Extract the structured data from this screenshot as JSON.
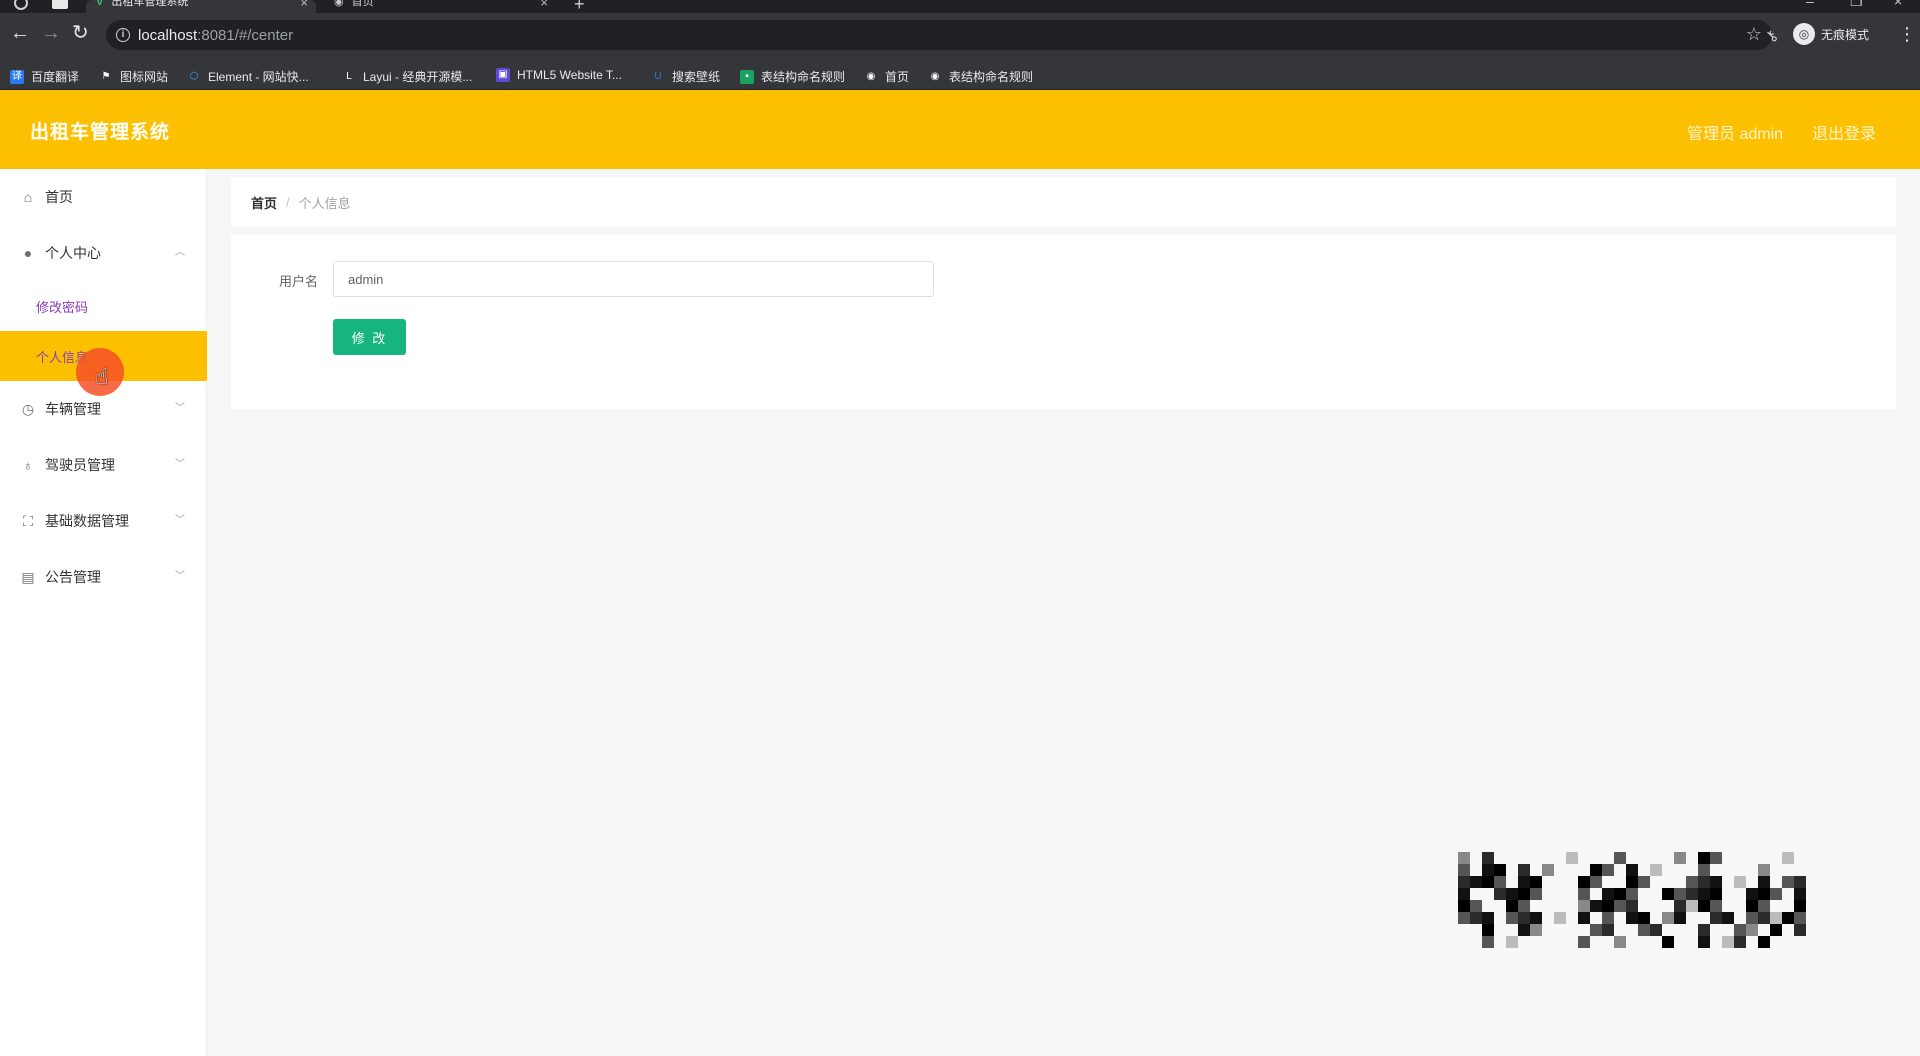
{
  "browser": {
    "tabs": [
      {
        "title": "出租车管理系统",
        "active": true
      },
      {
        "title": "首页",
        "active": false
      }
    ],
    "url_host": "localhost",
    "url_rest": ":8081/#/center",
    "profile_label": "无痕模式",
    "bookmarks": [
      {
        "label": "百度翻译",
        "icon_text": "译",
        "color": "#2b7bf0"
      },
      {
        "label": "图标网站",
        "icon_text": "⚑",
        "color": "#35363a"
      },
      {
        "label": "Element - 网站快...",
        "icon_text": "⬡",
        "color": "#409eff"
      },
      {
        "label": "Layui - 经典开源模...",
        "icon_text": "L",
        "color": "#35363a"
      },
      {
        "label": "HTML5 Website T...",
        "icon_text": "▣",
        "color": "#5c4bd6"
      },
      {
        "label": "搜索壁纸",
        "icon_text": "U",
        "color": "#3c6cdc"
      },
      {
        "label": "表结构命名规则",
        "icon_text": "▪",
        "color": "#1aa260"
      },
      {
        "label": "首页",
        "icon_text": "◉",
        "color": "#35363a"
      },
      {
        "label": "表结构命名规则",
        "icon_text": "◉",
        "color": "#35363a"
      }
    ]
  },
  "header": {
    "title": "出租车管理系统",
    "user": "管理员 admin",
    "logout": "退出登录"
  },
  "sidebar": {
    "home": "首页",
    "personal_center": "个人中心",
    "change_password": "修改密码",
    "personal_info": "个人信息",
    "vehicle_mgmt": "车辆管理",
    "driver_mgmt": "驾驶员管理",
    "basic_data_mgmt": "基础数据管理",
    "notice_mgmt": "公告管理"
  },
  "breadcrumb": {
    "home": "首页",
    "current": "个人信息"
  },
  "form": {
    "username_label": "用户名",
    "username_value": "admin",
    "submit_label": "修 改"
  },
  "colors": {
    "accent": "#fdc000",
    "button": "#16b47e",
    "submenu_text": "#8a3ab9"
  }
}
